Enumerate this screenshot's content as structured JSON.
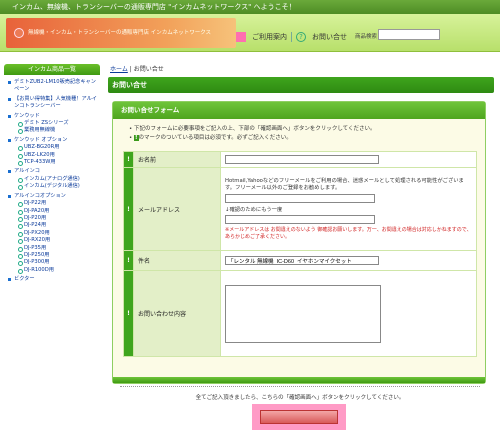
{
  "topstrip": {
    "text": "インカム、無線機、トランシーバーの通販専門店 \"インカムネットワークス\" へようこそ！"
  },
  "header": {
    "logo_text": "無線機・インカム・トランシーバーの通販専門店 インカムネットワークス",
    "guide_link": "ご利用案内",
    "contact_link": "お問い合せ",
    "search_label": "商品検索",
    "search_value": ""
  },
  "sidebar": {
    "heading": "インカム商品一覧",
    "items": [
      {
        "text": "デミトZUB2-LM10販売記念キャンペーン",
        "kind": "cat"
      },
      {
        "text": "【お買い得特集】人気機種！アルインコトランシーバー",
        "kind": "cat"
      },
      {
        "text": "ケンウッド",
        "kind": "cat"
      },
      {
        "text": "デミト ZSシリーズ",
        "kind": "sub"
      },
      {
        "text": "業務用無線機",
        "kind": "sub"
      },
      {
        "text": "ケンウッド オプション",
        "kind": "cat"
      },
      {
        "text": "UBZ-BG20R用",
        "kind": "sub"
      },
      {
        "text": "UBZ-LK20用",
        "kind": "sub"
      },
      {
        "text": "TCP-433W用",
        "kind": "sub"
      },
      {
        "text": "アルインコ",
        "kind": "cat"
      },
      {
        "text": "インカム(アナログ通信)",
        "kind": "sub"
      },
      {
        "text": "インカム(デジタル通信)",
        "kind": "sub"
      },
      {
        "text": "アルインコオプション",
        "kind": "cat"
      },
      {
        "text": "DJ-P22用",
        "kind": "sub"
      },
      {
        "text": "DJ-PA20用",
        "kind": "sub"
      },
      {
        "text": "DJ-P20用",
        "kind": "sub"
      },
      {
        "text": "DJ-P24用",
        "kind": "sub"
      },
      {
        "text": "DJ-PX20用",
        "kind": "sub"
      },
      {
        "text": "DJ-RX20用",
        "kind": "sub"
      },
      {
        "text": "DJ-P35用",
        "kind": "sub"
      },
      {
        "text": "DJ-P250用",
        "kind": "sub"
      },
      {
        "text": "DJ-P300用",
        "kind": "sub"
      },
      {
        "text": "DJ-R100D用",
        "kind": "sub"
      },
      {
        "text": "ビクター",
        "kind": "cat"
      }
    ]
  },
  "breadcrumb": {
    "home": "ホーム",
    "separator": "|",
    "current": "お問い合せ"
  },
  "page_title": "お問い合せ",
  "form": {
    "title": "お問い合せフォーム",
    "notes": [
      "下記のフォームに必要事項をご記入の上、下部の「確認画面へ」ボタンをクリックしてください。",
      "のマークのついている項目は必須です。必ずご記入ください。"
    ],
    "required_mark": "!",
    "fields": {
      "name": {
        "label": "お名前",
        "value": ""
      },
      "email": {
        "label": "メールアドレス",
        "help": "Hotmail,Yahooなどのフリーメールをご利用の場合、迷惑メールとして処理される可能性がございます。フリーメール以外のご登録をお勧めします。",
        "confirm_label": "↓確認のためにもう一度",
        "warning": "※メールアドレスは お間違えのないよう 御確認お願いします。万一、お間違えの場合は対応しかねますので、あらかじめご了承ください。",
        "value": "",
        "confirm_value": ""
      },
      "subject": {
        "label": "件名",
        "value": "「レンタル 無線機  IC-D60  イヤホンマイクセット"
      },
      "message": {
        "label": "お問い合わせ内容",
        "value": ""
      }
    },
    "submit_message": "全てご記入頂きましたら、こちらの「確認画面へ」ボタンをクリックしてください。"
  }
}
